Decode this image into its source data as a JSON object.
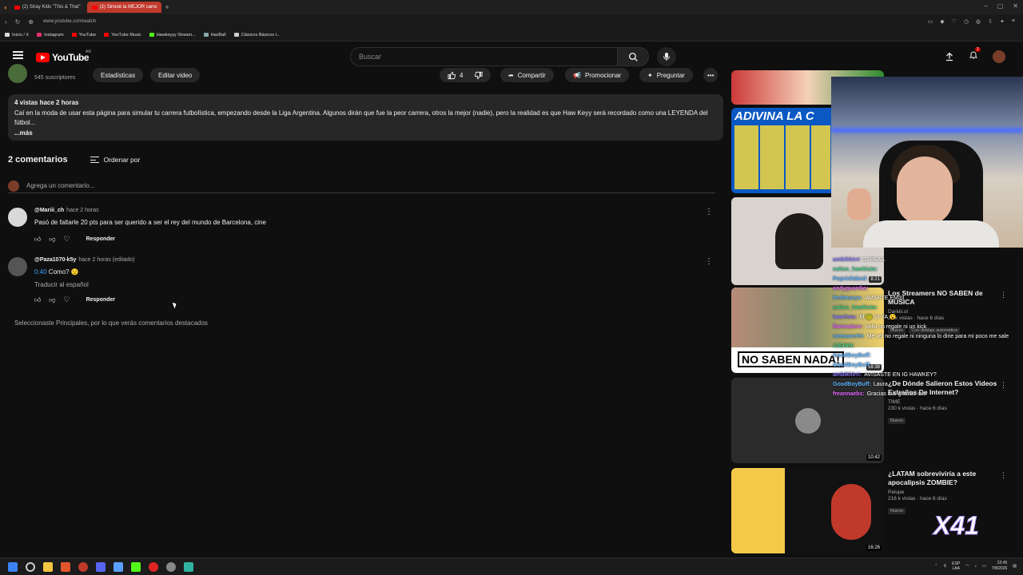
{
  "browser": {
    "tabs": [
      {
        "label": "(2) Stray Kids \"This & That\"",
        "active": false
      },
      {
        "label": "(2) Simulé la MEJOR carre",
        "active": true
      }
    ],
    "url": "www.youtube.com/watch",
    "bookmarks": [
      {
        "label": "Inicio / X",
        "color": "#dddddd"
      },
      {
        "label": "Instagram",
        "color": "#e1306c"
      },
      {
        "label": "YouTube",
        "color": "#ff0000"
      },
      {
        "label": "YouTube Music",
        "color": "#ff0000"
      },
      {
        "label": "Hawkeyyy Stream...",
        "color": "#53fc18"
      },
      {
        "label": "HaxBall",
        "color": "#8aa"
      },
      {
        "label": "Clásicos Básicos t...",
        "color": "#ccc"
      }
    ]
  },
  "youtube": {
    "logo_text": "YouTube",
    "country_code": "AR",
    "search_placeholder": "Buscar",
    "notification_count": "2"
  },
  "video": {
    "subscribers": "545 suscriptores",
    "stats_button": "Estadísticas",
    "edit_button": "Editar video",
    "likes": "4",
    "share_label": "Compartir",
    "promote_label": "Promocionar",
    "ask_label": "Preguntar",
    "description_meta": "4 vistas  hace 2 horas",
    "description_text": "Caí en la moda de usar esta página para simular tu carrera futbolística, empezando desde la Liga Argentina. Algunos dirán que fue la peor carrera, otros la mejor (nadie), pero la realidad es que Haw Keyy será recordado como una LEYENDA del fútbol...",
    "more_label": "...más"
  },
  "comments": {
    "count_label": "2 comentarios",
    "sort_label": "Ordenar por",
    "add_placeholder": "Agrega un comentario...",
    "items": [
      {
        "author": "@Mariii_ch",
        "time": "hace 2 horas",
        "text": "Pasó de faltarle 20 pts para ser querido a ser el rey del mundo de Barcelona, cine",
        "timestamp": "",
        "translate": "",
        "reply": "Responder"
      },
      {
        "author": "@Paza1070-k5y",
        "time": "hace 2 horas (editado)",
        "text": " Como? 😟",
        "timestamp": "0:40",
        "translate": "Traducir al español",
        "reply": "Responder"
      }
    ],
    "notice": "Seleccionaste Principales, por lo que verás comentarios destacados"
  },
  "sidebar": {
    "recommendations": [
      {
        "thumb_text": "",
        "duration": "",
        "title": "",
        "channel": "",
        "meta": "",
        "badge": "",
        "dub": ""
      },
      {
        "thumb_text": "ADIVINA LA C",
        "duration": "",
        "title": "",
        "channel": "",
        "meta": "",
        "badge": "",
        "dub": ""
      },
      {
        "thumb_text": "",
        "duration": "8:21",
        "title": "",
        "channel": "",
        "meta": "",
        "badge": "",
        "dub": ""
      },
      {
        "thumb_text": "NO SABEN NADA!",
        "duration": "18:38",
        "title": "Los Streamers NO SABEN de MUSICA",
        "channel": "Darkiii.ol",
        "meta": "23 k vistas · hace 6 días",
        "badge": "Nuevo",
        "dub": "Con doblaje automático"
      },
      {
        "thumb_text": "",
        "duration": "10:42",
        "title": "¿De Dónde Salieron Estos Videos Extraños De Internet?",
        "channel": "TIME",
        "meta": "230 k vistas · hace 6 días",
        "badge": "Nuevo",
        "dub": ""
      },
      {
        "thumb_text": "",
        "duration": "16:26",
        "title": "¿LATAM sobreviviría a este apocalipsis ZOMBIE?",
        "channel": "Pelupe",
        "meta": "216 k vistas · hace 6 días",
        "badge": "Nuevo",
        "dub": ""
      }
    ]
  },
  "stream_overlay": {
    "chat": [
      {
        "user": "ambikhirri",
        "msg": "CAPAAA",
        "cls": "u1"
      },
      {
        "user": "catius_hawkista:",
        "msg": "",
        "cls": "u2"
      },
      {
        "user": "Poprinfobed:",
        "msg": "",
        "cls": "u3"
      },
      {
        "user": "andyguardio:",
        "msg": "",
        "cls": "u4"
      },
      {
        "user": "fredmacyv:",
        "msg": "AMARTE EMIIII",
        "cls": "u3"
      },
      {
        "user": "catius_hawkista:",
        "msg": "",
        "cls": "u2"
      },
      {
        "user": "hawtista:",
        "msg": "M 🐸 VI YA 😮",
        "cls": "u1"
      },
      {
        "user": "Ramsalorv:",
        "msg": "volvi no regale ni un kick",
        "cls": "u4"
      },
      {
        "user": "ramsaverhi:",
        "msg": "Me vol no regale ni ninguna lo dirie para mi poco me sale",
        "cls": "u3"
      },
      {
        "user": "13EINN:",
        "msg": "",
        "cls": "u2"
      },
      {
        "user": "GoodBoyBuff:",
        "msg": "",
        "cls": "u3"
      },
      {
        "user": "GoodBoyBuff:",
        "msg": "",
        "cls": "u3"
      },
      {
        "user": "ambikhirri:",
        "msg": "AVISASTE EN IG HAWKEY?",
        "cls": "u1"
      },
      {
        "user": "GoodBoyBuff:",
        "msg": "Laura",
        "cls": "u3"
      },
      {
        "user": "freannaebs:",
        "msg": "Gracias ibai gracias ibai",
        "cls": "u4"
      }
    ],
    "gift_count": "X41"
  },
  "taskbar": {
    "language": "ESP",
    "layout": "LAA",
    "time": "22:45",
    "date": "7/8/2026"
  }
}
